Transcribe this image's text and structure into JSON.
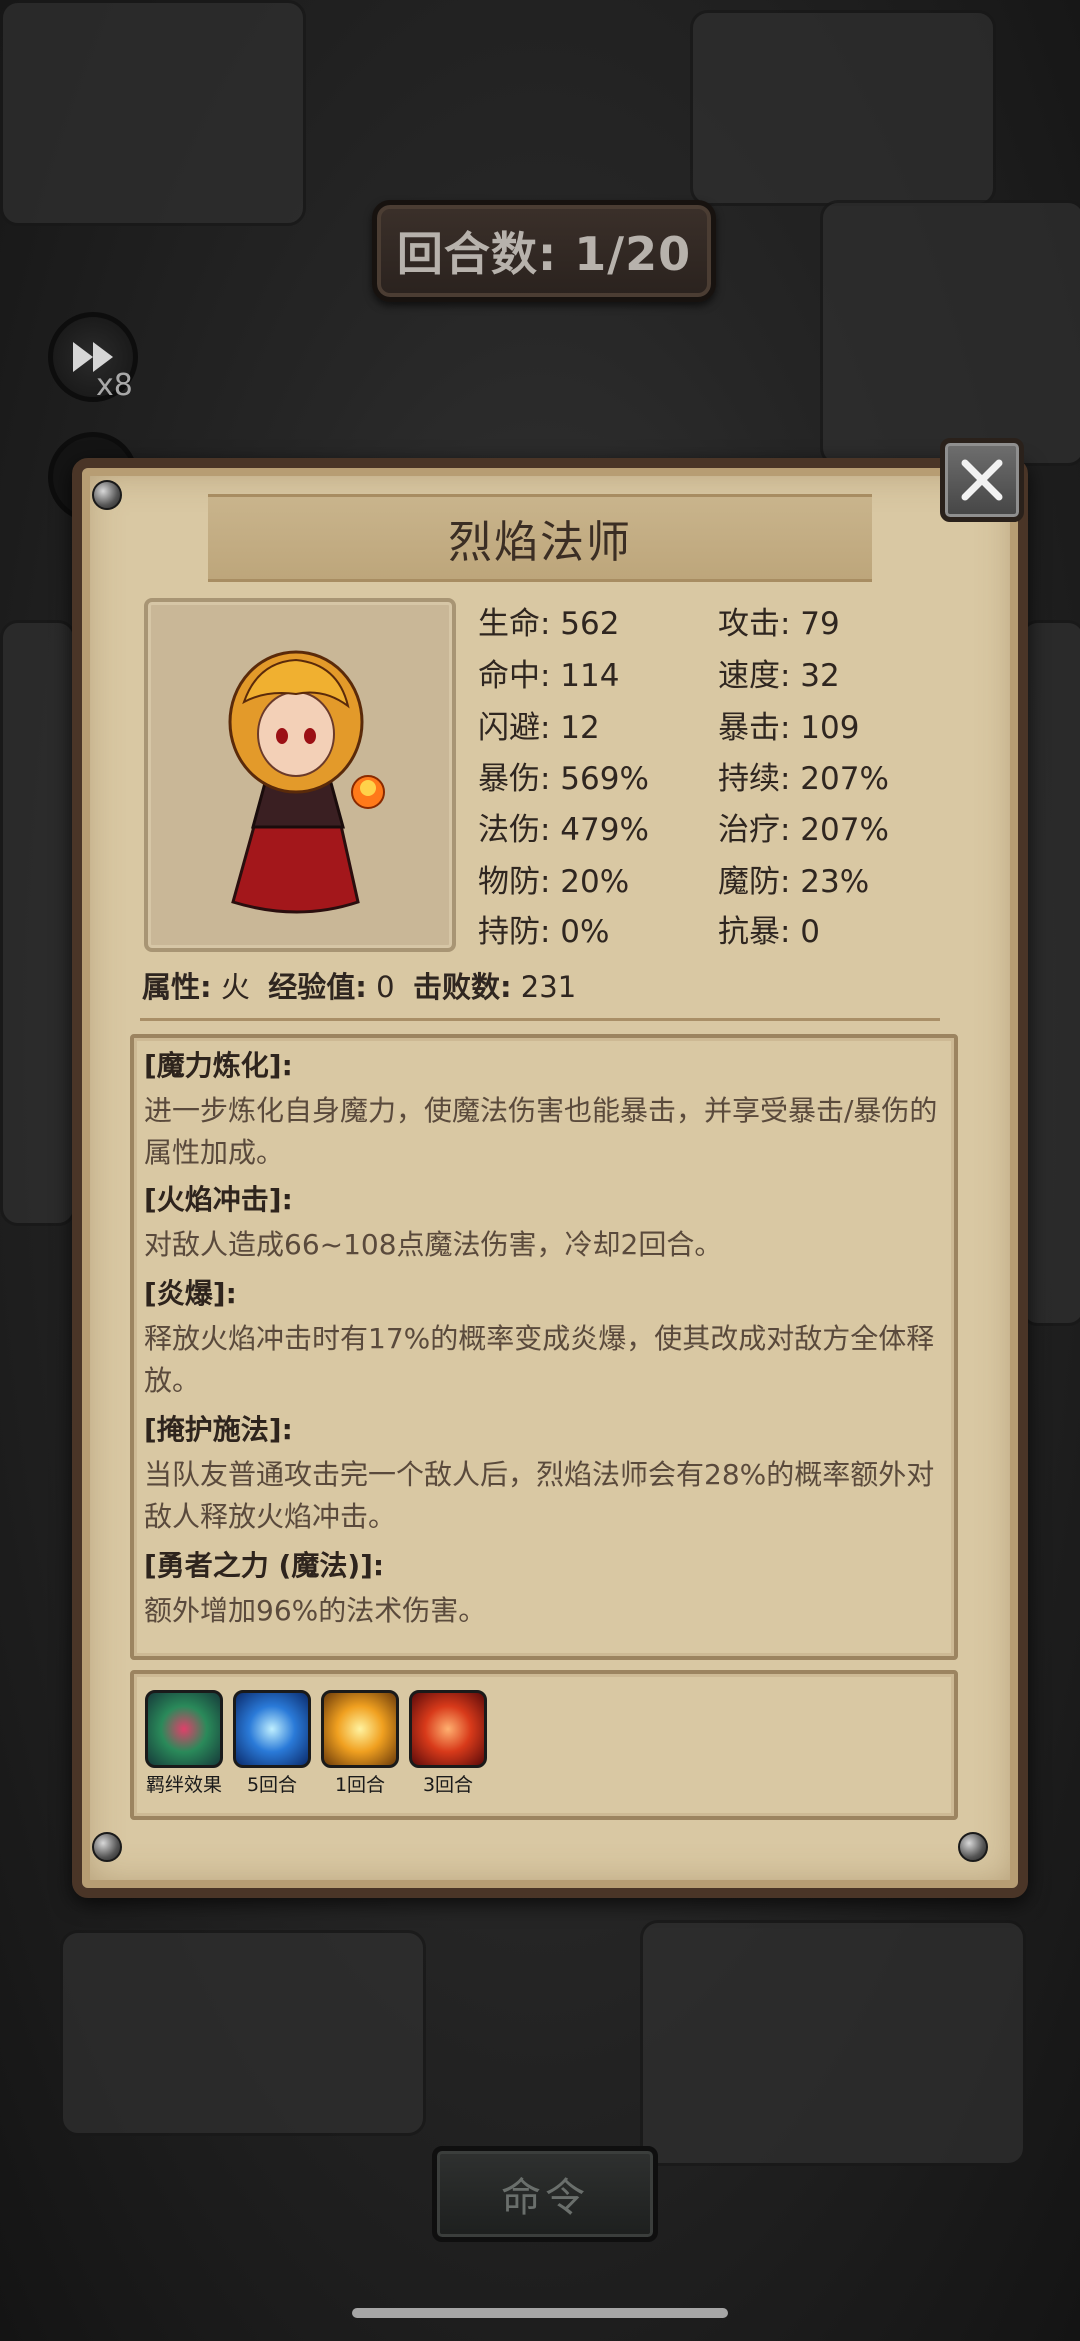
{
  "hud": {
    "round_label": "回合数: 1/20",
    "speed_multiplier": "x8"
  },
  "panel": {
    "title": "烈焰法师",
    "stats": [
      {
        "label": "生命: 562"
      },
      {
        "label": "攻击: 79"
      },
      {
        "label": "命中: 114"
      },
      {
        "label": "速度: 32"
      },
      {
        "label": "闪避: 12"
      },
      {
        "label": "暴击: 109"
      },
      {
        "label": "暴伤: 569%"
      },
      {
        "label": "持续: 207%"
      },
      {
        "label": "法伤: 479%"
      },
      {
        "label": "治疗: 207%"
      },
      {
        "label": "物防: 20%"
      },
      {
        "label": "魔防: 23%"
      },
      {
        "label": "持防: 0%"
      },
      {
        "label": "抗暴: 0"
      }
    ],
    "attributes": {
      "element_key": "属性:",
      "element_val": " 火",
      "exp_key": "经验值:",
      "exp_val": " 0",
      "kills_key": "击败数:",
      "kills_val": " 231"
    },
    "skills": [
      {
        "name": "[魔力炼化]:",
        "desc": "进一步炼化自身魔力，使魔法伤害也能暴击，并享受暴击/暴伤的属性加成。"
      },
      {
        "name": "[火焰冲击]:",
        "desc": "对敌人造成66~108点魔法伤害，冷却2回合。"
      },
      {
        "name": "[炎爆]:",
        "desc": "释放火焰冲击时有17%的概率变成炎爆，使其改成对敌方全体释放。"
      },
      {
        "name": "[掩护施法]:",
        "desc": "当队友普通攻击完一个敌人后，烈焰法师会有28%的概率额外对敌人释放火焰冲击。"
      },
      {
        "name": "[勇者之力 (魔法)]:",
        "desc": "额外增加96%的法术伤害。"
      }
    ],
    "buffs": [
      {
        "icon": "bond-effect-icon",
        "caption": "羁绊效果"
      },
      {
        "icon": "lightning-guard-icon",
        "caption": "5回合"
      },
      {
        "icon": "burst-light-icon",
        "caption": "1回合"
      },
      {
        "icon": "flame-fist-icon",
        "caption": "3回合"
      }
    ]
  },
  "command_button": "命令",
  "colors": {
    "panel_bg": "#d9c8a3",
    "panel_border": "#4a3527",
    "text_dark": "#2f2620",
    "desc_text": "#5a4a3c"
  }
}
